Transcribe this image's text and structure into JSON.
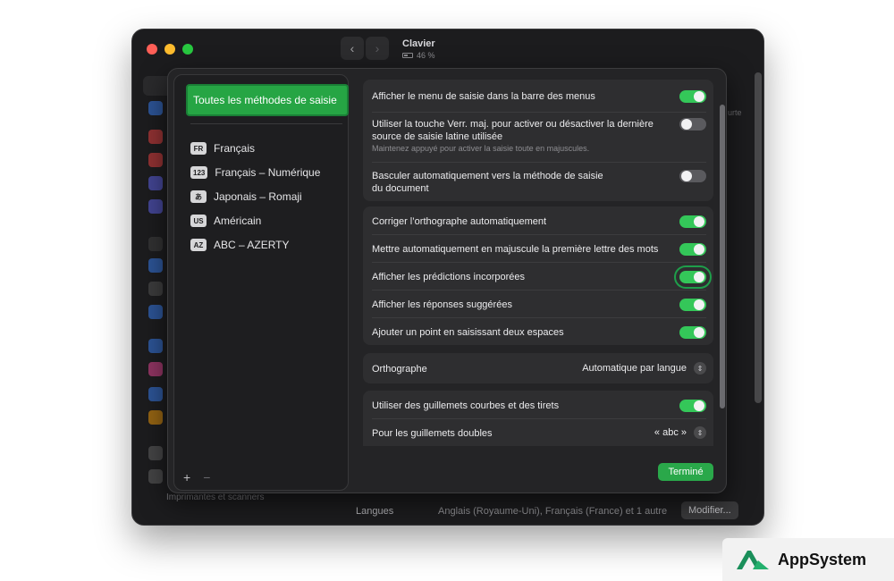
{
  "window": {
    "title": "Clavier",
    "battery": "46 %"
  },
  "background": {
    "sidebar_bottom_item": "Imprimantes et scanners",
    "languages_label": "Langues",
    "languages_value": "Anglais (Royaume-Uni), Français (France) et 1 autre",
    "modify_button": "Modifier...",
    "right_fragment": "urte"
  },
  "input_methods": {
    "selected": "Toutes les méthodes de saisie",
    "items": [
      {
        "badge": "FR",
        "label": "Français"
      },
      {
        "badge": "123",
        "label": "Français – Numérique"
      },
      {
        "badge": "あ",
        "label": "Japonais – Romaji"
      },
      {
        "badge": "US",
        "label": "Américain"
      },
      {
        "badge": "AZ",
        "label": "ABC – AZERTY"
      }
    ],
    "add_label": "+",
    "remove_label": "−"
  },
  "settings": {
    "group1": [
      {
        "label": "Afficher le menu de saisie dans la barre des menus",
        "on": true
      },
      {
        "label": "Utiliser la touche Verr. maj. pour activer ou désactiver la dernière source de saisie latine utilisée",
        "sub": "Maintenez appuyé pour activer la saisie toute en majuscules.",
        "on": false
      },
      {
        "label": "Basculer automatiquement vers la méthode de saisie du document",
        "on": false
      }
    ],
    "group2": [
      {
        "label": "Corriger l’orthographe automatiquement",
        "on": true
      },
      {
        "label": "Mettre automatiquement en majuscule la première lettre des mots",
        "on": true
      },
      {
        "label": "Afficher les prédictions incorporées",
        "on": true,
        "highlight": true
      },
      {
        "label": "Afficher les réponses suggérées",
        "on": true
      },
      {
        "label": "Ajouter un point en saisissant deux espaces",
        "on": true
      }
    ],
    "spelling_label": "Orthographe",
    "spelling_value": "Automatique par langue",
    "group3": [
      {
        "label": "Utiliser des guillemets courbes et des tirets",
        "on": true
      },
      {
        "label": "Pour les guillemets doubles",
        "value": "« abc »"
      }
    ]
  },
  "done_button": "Terminé",
  "brand": {
    "name": "AppSystem",
    "accent": "#1a8f5a"
  },
  "colors": {
    "toggle_on": "#34c759",
    "selected_bg": "#26a544",
    "highlight_outline": "#1e9e4a"
  }
}
